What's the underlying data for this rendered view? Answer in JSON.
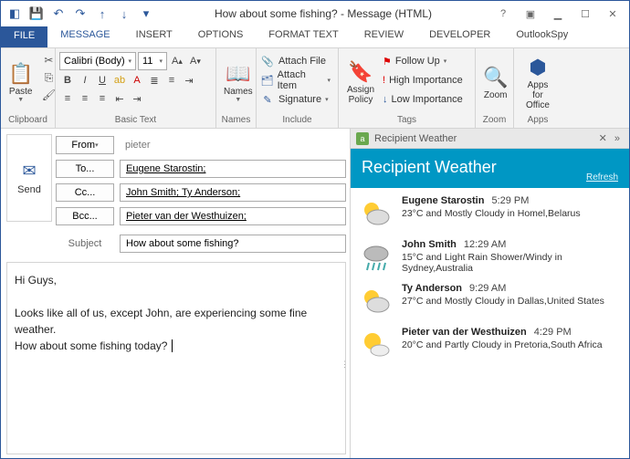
{
  "window": {
    "title": "How about some fishing? - Message (HTML)"
  },
  "tabs": {
    "file": "FILE",
    "message": "MESSAGE",
    "insert": "INSERT",
    "options": "OPTIONS",
    "format": "FORMAT TEXT",
    "review": "REVIEW",
    "developer": "DEVELOPER",
    "spy": "OutlookSpy"
  },
  "ribbon": {
    "clipboard": {
      "paste": "Paste",
      "label": "Clipboard"
    },
    "font": {
      "name": "Calibri (Body)",
      "size": "11",
      "label": "Basic Text"
    },
    "names": {
      "btn": "Names",
      "label": "Names"
    },
    "include": {
      "attach_file": "Attach File",
      "attach_item": "Attach Item",
      "signature": "Signature",
      "label": "Include"
    },
    "tags": {
      "assign": "Assign\nPolicy",
      "follow_up": "Follow Up",
      "high": "High Importance",
      "low": "Low Importance",
      "label": "Tags"
    },
    "zoom": {
      "btn": "Zoom",
      "label": "Zoom"
    },
    "apps": {
      "btn": "Apps for\nOffice",
      "label": "Apps"
    }
  },
  "compose": {
    "send": "Send",
    "from_btn": "From",
    "from_val": "pieter",
    "to_btn": "To...",
    "to_val": "Eugene Starostin;",
    "cc_btn": "Cc...",
    "cc_val": "John Smith; Ty Anderson;",
    "bcc_btn": "Bcc...",
    "bcc_val": "Pieter van der Westhuizen;",
    "subject_lbl": "Subject",
    "subject_val": "How about some fishing?",
    "body_l1": "Hi Guys,",
    "body_l2": "Looks like all of us, except John, are experiencing some fine weather.",
    "body_l3": "How about some fishing today?"
  },
  "panel": {
    "top_title": "Recipient Weather",
    "banner_title": "Recipient Weather",
    "refresh": "Refresh",
    "items": [
      {
        "name": "Eugene Starostin",
        "time": "5:29 PM",
        "desc": "23°C and Mostly Cloudy in Homel,Belarus",
        "icon": "mostly-cloudy"
      },
      {
        "name": "John Smith",
        "time": "12:29 AM",
        "desc": "15°C and Light Rain Shower/Windy in Sydney,Australia",
        "icon": "rain"
      },
      {
        "name": "Ty Anderson",
        "time": "9:29 AM",
        "desc": "27°C and Mostly Cloudy in Dallas,United States",
        "icon": "mostly-cloudy"
      },
      {
        "name": "Pieter van der Westhuizen",
        "time": "4:29 PM",
        "desc": "20°C and Partly Cloudy in Pretoria,South Africa",
        "icon": "partly-cloudy"
      }
    ]
  }
}
